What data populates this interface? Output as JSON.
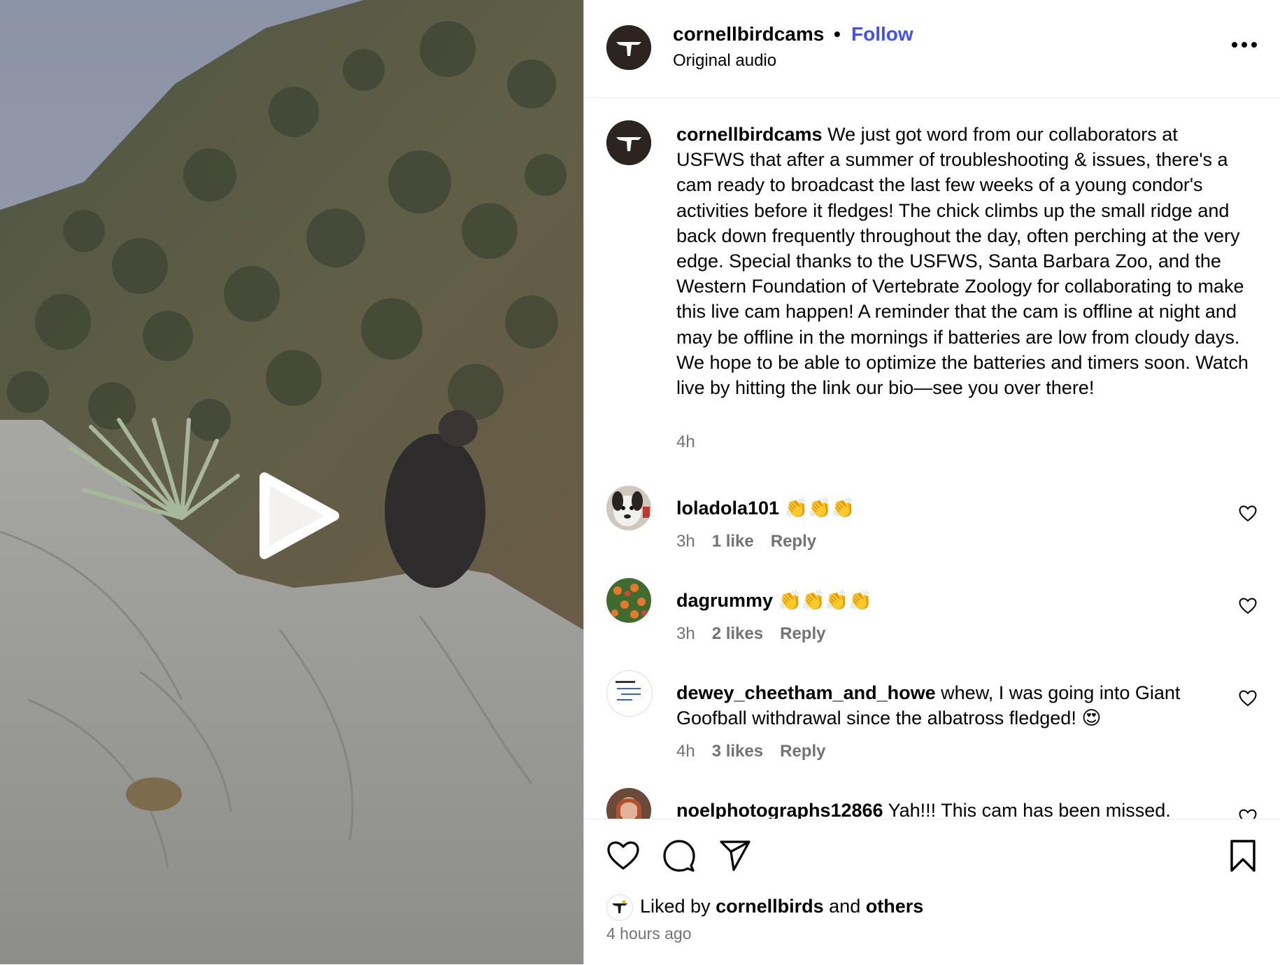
{
  "post": {
    "username": "cornellbirdcams",
    "dot": "•",
    "follow_label": "Follow",
    "audio_label": "Original audio",
    "more_icon": "more-options-icon",
    "caption_user": "cornellbirdcams",
    "caption_text": "We just got word from our collaborators at USFWS that after a summer of troubleshooting & issues, there's a cam ready to broadcast the last few weeks of a young condor's activities before it fledges! The chick climbs up the small ridge and back down frequently throughout the day, often perching at the very edge. Special thanks to the USFWS, Santa Barbara Zoo, and the Western Foundation of Vertebrate Zoology for collaborating to make this live cam happen! A reminder that the cam is offline at night and may be offline in the mornings if batteries are low from cloudy days. We hope to be able to optimize the batteries and timers soon. Watch live by hitting the link our bio—see you over there!",
    "caption_time": "4h"
  },
  "comments": [
    {
      "user": "loladola101",
      "text": "👏👏👏",
      "time": "3h",
      "likes": "1 like",
      "reply": "Reply"
    },
    {
      "user": "dagrummy",
      "text": "👏👏👏👏",
      "time": "3h",
      "likes": "2 likes",
      "reply": "Reply"
    },
    {
      "user": "dewey_cheetham_and_howe",
      "text": "whew, I was going into Giant Goofball withdrawal since the albatross fledged! 😍",
      "time": "4h",
      "likes": "3 likes",
      "reply": "Reply"
    },
    {
      "user": "noelphotographs12866",
      "text": "Yah!!! This cam has been missed."
    }
  ],
  "footer": {
    "liked_prefix": "Liked by",
    "liked_user": "cornellbirds",
    "liked_and": "and",
    "liked_others": "others",
    "posted_ago": "4 hours ago"
  },
  "colors": {
    "follow": "#4150f7",
    "meta": "#737373",
    "avatar_bg": "#2b2421"
  }
}
